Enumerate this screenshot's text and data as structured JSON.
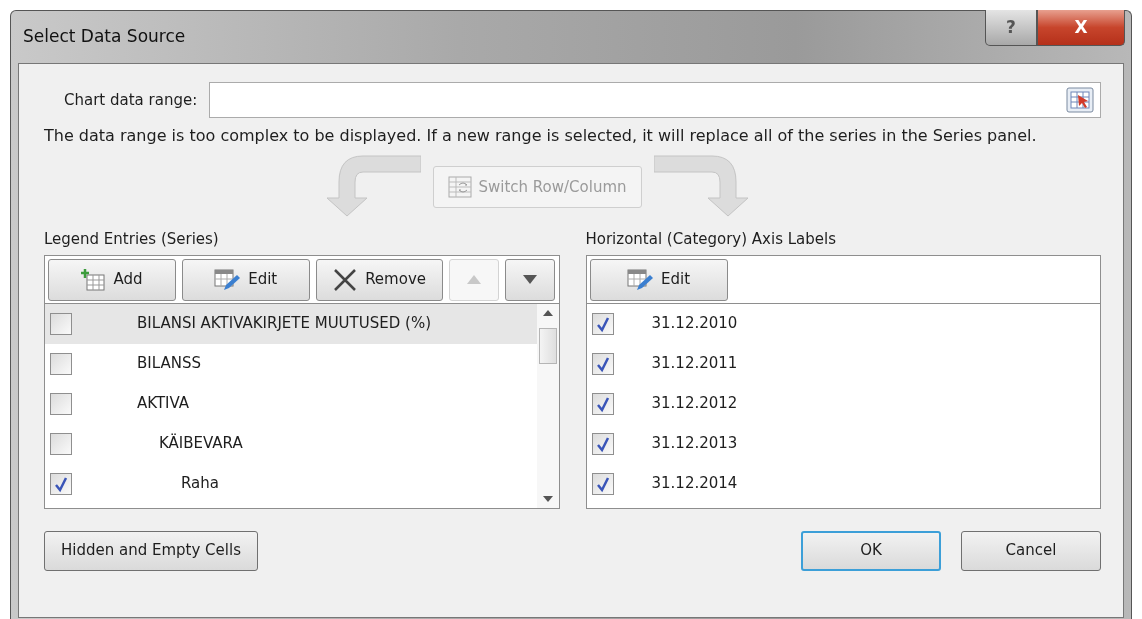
{
  "window": {
    "title": "Select Data Source"
  },
  "title_buttons": [
    {
      "kind": "help",
      "label": "?"
    },
    {
      "kind": "close",
      "label": "X"
    }
  ],
  "chart_data_range": {
    "label": "Chart data range:"
  },
  "message": "The data range is too complex to be displayed. If a new range is selected, it will replace all of the series in the Series panel.",
  "switch_button": {
    "label": "Switch Row/Column",
    "disabled": true
  },
  "legend_entries": {
    "title": "Legend Entries (Series)",
    "toolbar": [
      {
        "kind": "add",
        "label": "Add",
        "disabled": false
      },
      {
        "kind": "edit",
        "label": "Edit",
        "disabled": false
      },
      {
        "kind": "remove",
        "label": "Remove",
        "disabled": false
      },
      {
        "kind": "up",
        "disabled": true
      },
      {
        "kind": "down",
        "disabled": false
      }
    ],
    "items": [
      {
        "label": "BILANSI AKTIVAKIRJETE MUUTUSED (%)",
        "checked": false,
        "selected": true
      },
      {
        "label": "BILANSS",
        "checked": false,
        "selected": false
      },
      {
        "label": "AKTIVA",
        "checked": false,
        "selected": false,
        "children": [
          {
            "label": "KÄIBEVARA",
            "checked": false,
            "selected": false,
            "children": [
              {
                "label": "Raha",
                "checked": true,
                "selected": false
              }
            ]
          }
        ]
      }
    ]
  },
  "axis_labels": {
    "title": "Horizontal (Category) Axis Labels",
    "edit_button": {
      "label": "Edit"
    },
    "items": [
      {
        "label": "31.12.2010",
        "checked": true
      },
      {
        "label": "31.12.2011",
        "checked": true
      },
      {
        "label": "31.12.2012",
        "checked": true
      },
      {
        "label": "31.12.2013",
        "checked": true
      },
      {
        "label": "31.12.2014",
        "checked": true
      }
    ]
  },
  "buttons": [
    {
      "label": "Hidden and Empty Cells",
      "default": false
    },
    {
      "label": "OK",
      "default": true
    },
    {
      "label": "Cancel",
      "default": false
    }
  ]
}
